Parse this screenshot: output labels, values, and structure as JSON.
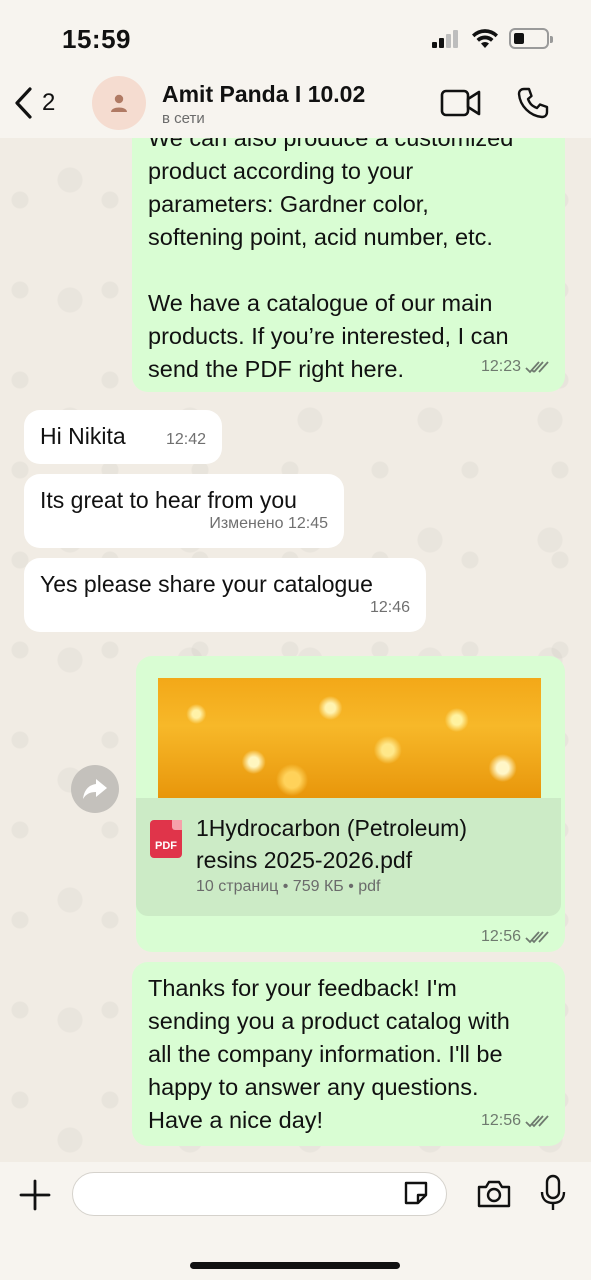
{
  "status_bar": {
    "time": "15:59"
  },
  "header": {
    "back_count": "2",
    "contact_name": "Amit Panda I 10.02",
    "contact_status": "в сети"
  },
  "messages": [
    {
      "direction": "out",
      "text": "We can also produce a customized\nproduct according to your\nparameters: Gardner color,\nsoftening point, acid number, etc.\n\nWe have a catalogue of our main\nproducts. If you’re interested, I can\nsend the PDF right here.",
      "time": "12:23"
    },
    {
      "direction": "in",
      "text": "Hi Nikita",
      "time": "12:42"
    },
    {
      "direction": "in",
      "text": "Its great to hear from you",
      "time": "Изменено 12:45"
    },
    {
      "direction": "in",
      "text": "Yes please share your catalogue",
      "time": "12:46"
    },
    {
      "direction": "out",
      "type": "document",
      "time": "12:56"
    },
    {
      "direction": "out",
      "text": "Thanks for your feedback! I'm\nsending you a product catalog with\nall the company information. I'll be\nhappy to answer any questions.\nHave a nice day!",
      "time": "12:56"
    }
  ],
  "document": {
    "icon_label": "PDF",
    "name": "1Hydrocarbon (Petroleum)\nresins 2025-2026.pdf",
    "details": "10 страниц • 759 КБ • pdf"
  },
  "colors": {
    "outgoing_bubble": "#d9fdd3",
    "incoming_bubble": "#ffffff",
    "background": "#f1ece4",
    "pdf_red": "#e0344a"
  }
}
